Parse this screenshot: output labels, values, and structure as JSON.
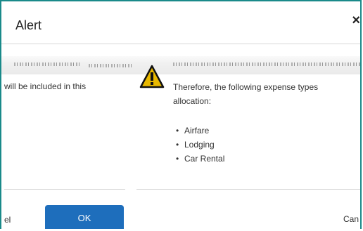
{
  "dialog": {
    "title": "Alert",
    "close_glyph": "×",
    "close_icon": "close-icon"
  },
  "left_panel": {
    "text": "will be included in this",
    "cancel_label": "el",
    "ok_label": "OK"
  },
  "message": {
    "line1": "Therefore, the following expense types",
    "line2": "allocation:",
    "items": [
      "Airfare",
      "Lodging",
      "Car Rental"
    ],
    "icon": "warning-icon"
  },
  "footer": {
    "cancel_label": "Can"
  },
  "colors": {
    "border": "#1a8a8a",
    "primary_button": "#1e6ebc",
    "warning_fill": "#e8b800"
  }
}
